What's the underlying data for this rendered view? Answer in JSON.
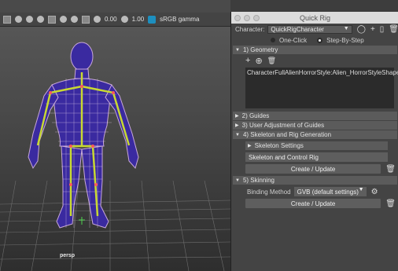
{
  "viewport": {
    "toolbar": {
      "field1": "0.00",
      "field2": "1.00",
      "color_space": "sRGB gamma"
    },
    "camera_label": "persp"
  },
  "window": {
    "title": "Quick Rig",
    "character_label": "Character:",
    "character_value": "QuickRigCharacter",
    "modes": [
      "One-Click",
      "Step-By-Step"
    ],
    "selected_mode": "Step-By-Step"
  },
  "sections": {
    "geometry": "1) Geometry",
    "geometry_item": "CharacterFullAlienHorrorStyle:Alien_HorrorStyleShape",
    "guides": "2) Guides",
    "user_adjust": "3) User Adjustment of Guides",
    "skeleton": "4) Skeleton and Rig Generation",
    "skeleton_settings": "Skeleton Settings",
    "skeleton_dropdown": "Skeleton and Control Rig",
    "create_update": "Create / Update",
    "skinning": "5) Skinning",
    "binding_label": "Binding Method",
    "binding_value": "GVB (default settings)",
    "create_update_2": "Create / Update"
  },
  "colors": {
    "panel_bg": "#444444",
    "header_bg": "#5b5b5b",
    "viewport_bg": "#4a4a4a",
    "mesh_lines": "#c8a8d8",
    "mesh_fill": "#3a2aa0",
    "joint": "#c8d832"
  }
}
